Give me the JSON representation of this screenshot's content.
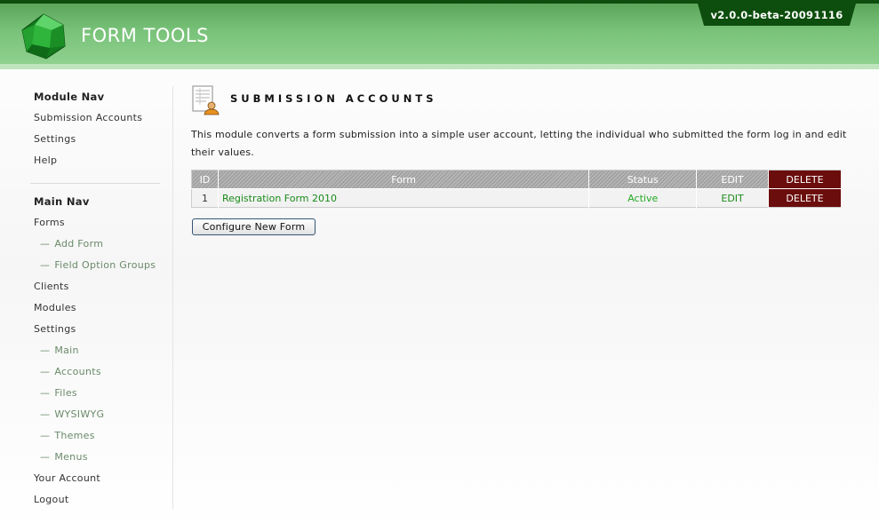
{
  "header": {
    "app_title": "FORM TOOLS",
    "version": "v2.0.0-beta-20091116",
    "colors": {
      "header_green": "#79c279",
      "dark_green": "#0d4d0d",
      "gem_green": "#1f9a2a"
    }
  },
  "sidebar": {
    "module_nav": {
      "heading": "Module Nav",
      "items": [
        "Submission Accounts",
        "Settings",
        "Help"
      ]
    },
    "main_nav": {
      "heading": "Main Nav",
      "forms": "Forms",
      "forms_sub": [
        "Add Form",
        "Field Option Groups"
      ],
      "clients": "Clients",
      "modules": "Modules",
      "settings": "Settings",
      "settings_sub": [
        "Main",
        "Accounts",
        "Files",
        "WYSIWYG",
        "Themes",
        "Menus"
      ],
      "your_account": "Your Account",
      "logout": "Logout"
    },
    "dash": "—"
  },
  "main": {
    "title": "SUBMISSION ACCOUNTS",
    "page_icon": "document-user-icon",
    "description": "This module converts a form submission into a simple user account, letting the individual who submitted the form log in and edit their values.",
    "table": {
      "headers": {
        "id": "ID",
        "form": "Form",
        "status": "Status",
        "edit": "EDIT",
        "delete": "DELETE"
      },
      "rows": [
        {
          "id": "1",
          "form": "Registration Form 2010",
          "status": "Active",
          "edit": "EDIT",
          "delete": "DELETE"
        }
      ],
      "delete_color": "#6b0d0d",
      "link_color": "#1a8a1a"
    },
    "configure_button": "Configure New Form"
  }
}
